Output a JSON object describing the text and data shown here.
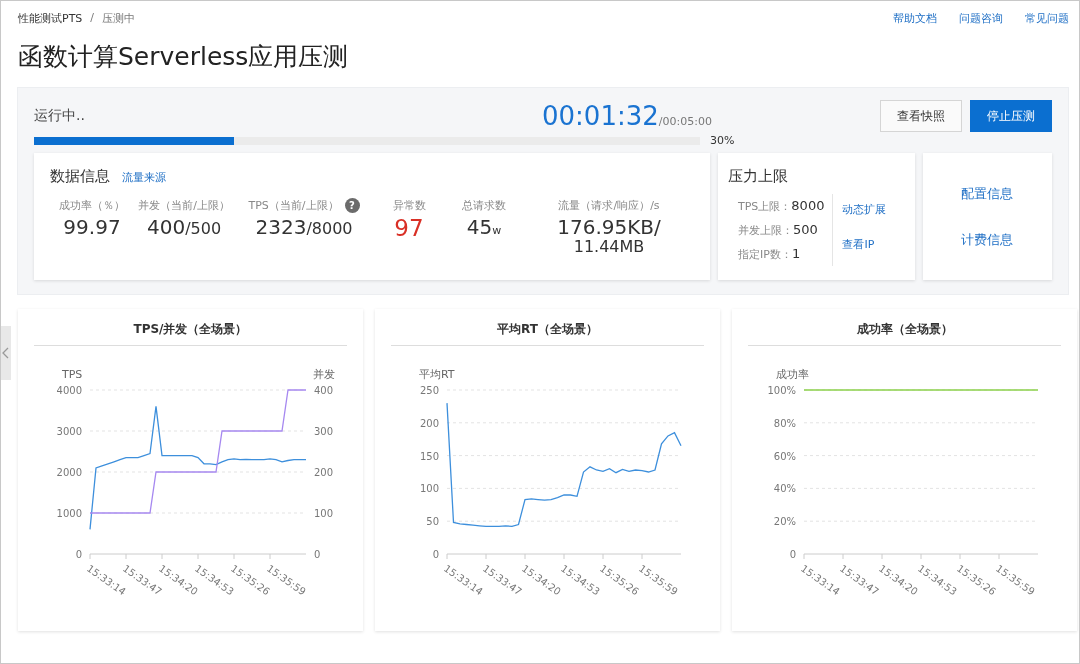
{
  "breadcrumb": [
    "性能测试PTS",
    "压测中"
  ],
  "breadcrumb_separator": "/",
  "header_links": [
    "帮助文档",
    "问题咨询",
    "常见问题"
  ],
  "title": "函数计算Serverless应用压测",
  "run": {
    "status": "运行中..",
    "elapsed": "00:01:32",
    "total": "/00:05:00",
    "level": 0.3,
    "percent": "30%",
    "buttons": [
      {
        "label": "查看快照",
        "kind": "default"
      },
      {
        "label": "停止压测",
        "kind": "primary"
      }
    ]
  },
  "data_info": {
    "title": "数据信息",
    "link": "流量来源",
    "metrics": [
      {
        "label": "成功率（％）",
        "value": "99.97"
      },
      {
        "label": "并发（当前/上限）",
        "value": "400",
        "suffix": "/500"
      },
      {
        "label": "TPS（当前/上限）",
        "value": "2323",
        "suffix": "/8000",
        "help": "?"
      },
      {
        "label": "异常数",
        "value": "97",
        "kind": "error"
      },
      {
        "label": "总请求数",
        "value": "45",
        "suffix": "w",
        "kind": "small-suffix"
      },
      {
        "label": "流量（请求/响应）/s",
        "value": "176.95KB/",
        "second_line": "11.44MB"
      }
    ]
  },
  "pressure": {
    "title": "压力上限",
    "rows": [
      {
        "label": "TPS上限：",
        "value": "8000"
      },
      {
        "label": "并发上限：",
        "value": "500"
      },
      {
        "label": "指定IP数：",
        "value": "1"
      }
    ],
    "links": [
      "动态扩展",
      "查看IP"
    ]
  },
  "side_links": [
    "配置信息",
    "计费信息"
  ],
  "charts": [
    {
      "title": "TPS/并发（全场景）",
      "chart_data": {
        "type": "line",
        "grid": true,
        "ylabel": "TPS",
        "y2label": "并发",
        "categories": [
          "15:33:14",
          null,
          null,
          null,
          null,
          null,
          "15:33:47",
          null,
          null,
          null,
          null,
          null,
          "15:34:20",
          null,
          null,
          null,
          null,
          null,
          "15:34:53",
          null,
          null,
          null,
          null,
          null,
          "15:35:26",
          null,
          null,
          null,
          null,
          null,
          "15:35:59",
          null,
          null,
          null,
          null,
          null,
          null
        ],
        "ylim": [
          0,
          4000
        ],
        "yticks": [
          0,
          1000,
          2000,
          3000,
          4000
        ],
        "y2lim": [
          0,
          400
        ],
        "y2ticks": [
          0,
          100,
          200,
          300,
          400
        ],
        "series": [
          {
            "color": "#3d8fdc",
            "values": [
              600,
              2100,
              2150,
              2200,
              2250,
              2300,
              2350,
              2350,
              2350,
              2400,
              2450,
              3600,
              2400,
              2400,
              2400,
              2400,
              2400,
              2400,
              2350,
              2200,
              2200,
              2180,
              2250,
              2300,
              2320,
              2300,
              2310,
              2300,
              2300,
              2300,
              2320,
              2300,
              2250,
              2280,
              2300,
              2300,
              2300
            ]
          },
          {
            "color": "#a688f0",
            "axis": "y2",
            "values": [
              100,
              100,
              100,
              100,
              100,
              100,
              100,
              100,
              100,
              100,
              100,
              200,
              200,
              200,
              200,
              200,
              200,
              200,
              200,
              200,
              200,
              200,
              300,
              300,
              300,
              300,
              300,
              300,
              300,
              300,
              300,
              300,
              300,
              400,
              400,
              400,
              400
            ]
          }
        ]
      }
    },
    {
      "title": "平均RT（全场景）",
      "chart_data": {
        "type": "line",
        "grid": true,
        "ylabel": "平均RT",
        "categories": [
          "15:33:14",
          null,
          null,
          null,
          null,
          null,
          "15:33:47",
          null,
          null,
          null,
          null,
          null,
          "15:34:20",
          null,
          null,
          null,
          null,
          null,
          "15:34:53",
          null,
          null,
          null,
          null,
          null,
          "15:35:26",
          null,
          null,
          null,
          null,
          null,
          "15:35:59",
          null,
          null,
          null,
          null,
          null,
          null
        ],
        "ylim": [
          0,
          250
        ],
        "yticks": [
          0,
          50,
          100,
          150,
          200,
          250
        ],
        "series": [
          {
            "color": "#3d8fdc",
            "values": [
              230,
              48,
              46,
              45,
              44,
              43,
              42,
              42,
              42,
              43,
              42,
              45,
              83,
              84,
              83,
              82,
              83,
              86,
              90,
              90,
              88,
              125,
              133,
              128,
              126,
              130,
              124,
              129,
              126,
              128,
              127,
              125,
              128,
              168,
              180,
              185,
              165
            ]
          }
        ]
      }
    },
    {
      "title": "成功率（全场景）",
      "chart_data": {
        "type": "line",
        "grid": true,
        "ylabel": "成功率",
        "categories": [
          "15:33:14",
          null,
          null,
          null,
          null,
          null,
          "15:33:47",
          null,
          null,
          null,
          null,
          null,
          "15:34:20",
          null,
          null,
          null,
          null,
          null,
          "15:34:53",
          null,
          null,
          null,
          null,
          null,
          "15:35:26",
          null,
          null,
          null,
          null,
          null,
          "15:35:59",
          null,
          null,
          null,
          null,
          null,
          null
        ],
        "ylim": [
          0,
          100
        ],
        "yticks": [
          {
            "value": 0,
            "label": "0"
          },
          {
            "value": 20,
            "label": "20%"
          },
          {
            "value": 40,
            "label": "40%"
          },
          {
            "value": 60,
            "label": "60%"
          },
          {
            "value": 80,
            "label": "80%"
          },
          {
            "value": 100,
            "label": "100%"
          }
        ],
        "series": [
          {
            "color": "#8bd14a",
            "values": [
              100,
              100,
              100,
              100,
              100,
              100,
              100,
              100,
              100,
              100,
              100,
              100,
              100,
              100,
              100,
              100,
              100,
              100,
              100,
              100,
              100,
              100,
              100,
              100,
              100,
              100,
              100,
              100,
              100,
              100,
              100,
              100,
              100,
              100,
              100,
              100,
              100
            ]
          }
        ]
      }
    }
  ]
}
